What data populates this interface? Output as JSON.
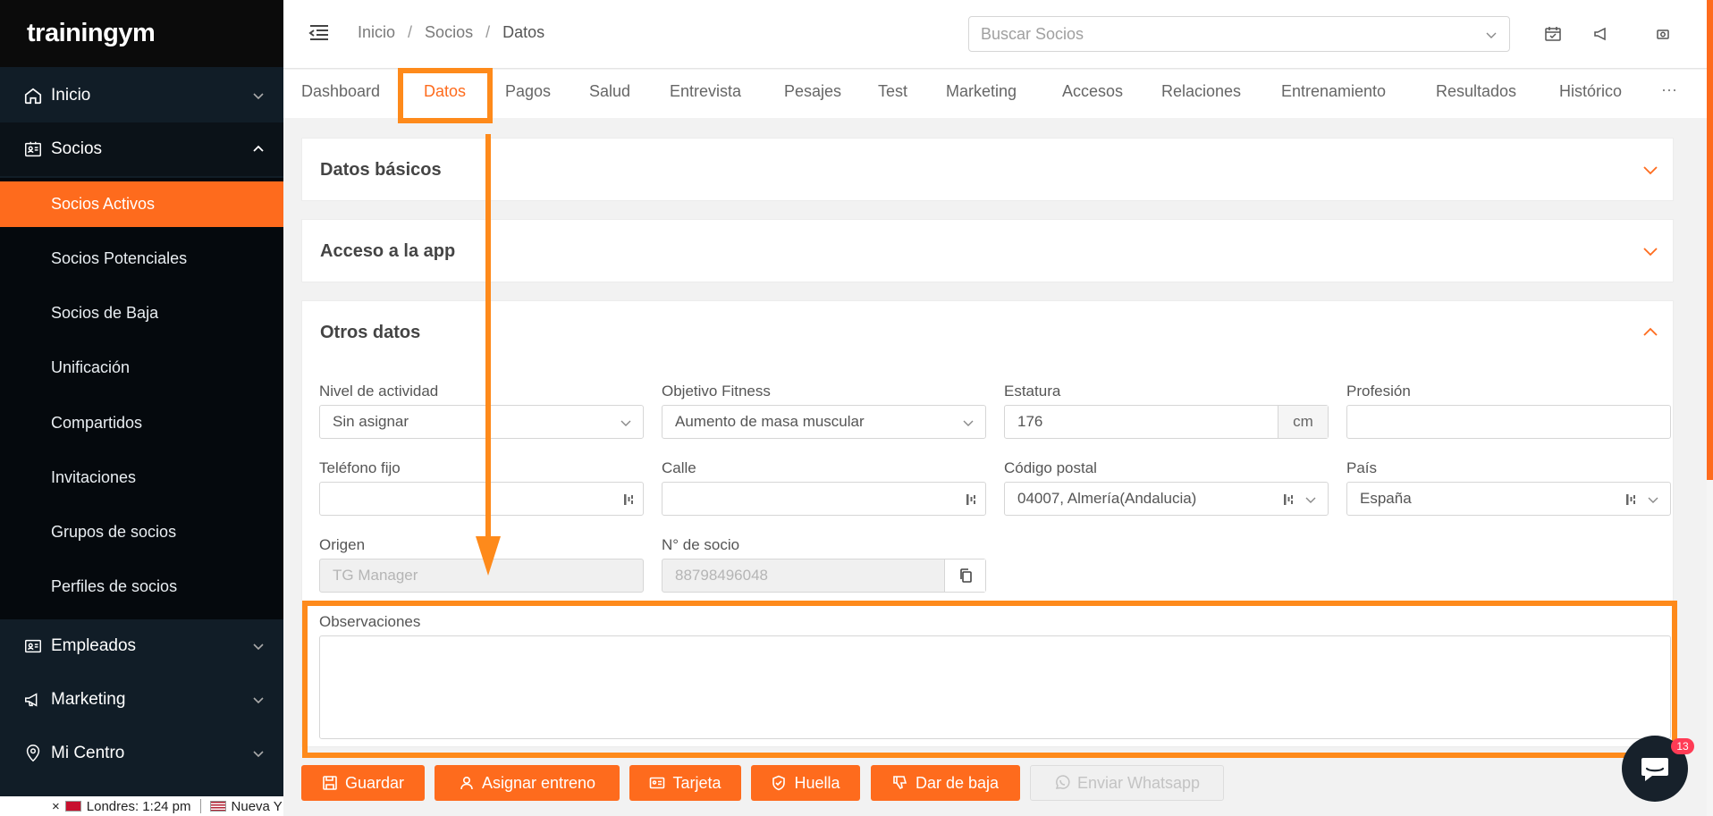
{
  "brand": {
    "logo_text": "trainingym",
    "accent": "#fe6b1d",
    "annotation_color": "#fe8a1b"
  },
  "sidebar": {
    "items": [
      {
        "label": "Inicio",
        "icon": "home-icon"
      },
      {
        "label": "Socios",
        "icon": "id-card-icon",
        "expanded": true
      },
      {
        "label": "Empleados",
        "icon": "badge-icon"
      },
      {
        "label": "Marketing",
        "icon": "megaphone-icon"
      },
      {
        "label": "Mi Centro",
        "icon": "location-pin-icon"
      }
    ],
    "socios_sub": [
      {
        "label": "Socios Activos",
        "active": true
      },
      {
        "label": "Socios Potenciales"
      },
      {
        "label": "Socios de Baja"
      },
      {
        "label": "Unificación"
      },
      {
        "label": "Compartidos"
      },
      {
        "label": "Invitaciones"
      },
      {
        "label": "Grupos de socios"
      },
      {
        "label": "Perfiles de socios"
      }
    ],
    "ticker": {
      "close": "×",
      "city1": "Londres: 1:24 pm",
      "city2": "Nueva Y"
    }
  },
  "header": {
    "breadcrumb": [
      "Inicio",
      "Socios",
      "Datos"
    ],
    "search_placeholder": "Buscar Socios"
  },
  "tabs": [
    "Dashboard",
    "Datos",
    "Pagos",
    "Salud",
    "Entrevista",
    "Pesajes",
    "Test",
    "Marketing",
    "Accesos",
    "Relaciones",
    "Entrenamiento",
    "Resultados",
    "Histórico"
  ],
  "active_tab": "Datos",
  "tab_more": "···",
  "panels": {
    "datos_basicos": "Datos básicos",
    "acceso_app": "Acceso a la app",
    "otros_datos": "Otros datos"
  },
  "form": {
    "nivel_actividad": {
      "label": "Nivel de actividad",
      "value": "Sin asignar"
    },
    "objetivo_fitness": {
      "label": "Objetivo Fitness",
      "value": "Aumento de masa muscular"
    },
    "estatura": {
      "label": "Estatura",
      "value": "176",
      "unit": "cm"
    },
    "profesion": {
      "label": "Profesión",
      "value": ""
    },
    "telefono_fijo": {
      "label": "Teléfono fijo",
      "value": ""
    },
    "calle": {
      "label": "Calle",
      "value": ""
    },
    "codigo_postal": {
      "label": "Código postal",
      "value": "04007, Almería(Andalucia)"
    },
    "pais": {
      "label": "País",
      "value": "España"
    },
    "origen": {
      "label": "Origen",
      "value": "TG Manager"
    },
    "n_socio": {
      "label": "N° de socio",
      "value": "88798496048"
    },
    "observaciones": {
      "label": "Observaciones",
      "value": ""
    }
  },
  "actions": [
    {
      "label": "Guardar",
      "icon": "save-icon"
    },
    {
      "label": "Asignar entreno",
      "icon": "user-icon"
    },
    {
      "label": "Tarjeta",
      "icon": "card-icon"
    },
    {
      "label": "Huella",
      "icon": "shield-check-icon"
    },
    {
      "label": "Dar de baja",
      "icon": "thumbs-down-icon"
    },
    {
      "label": "Enviar Whatsapp",
      "icon": "whatsapp-icon",
      "disabled": true
    }
  ],
  "chat": {
    "badge": "13"
  }
}
